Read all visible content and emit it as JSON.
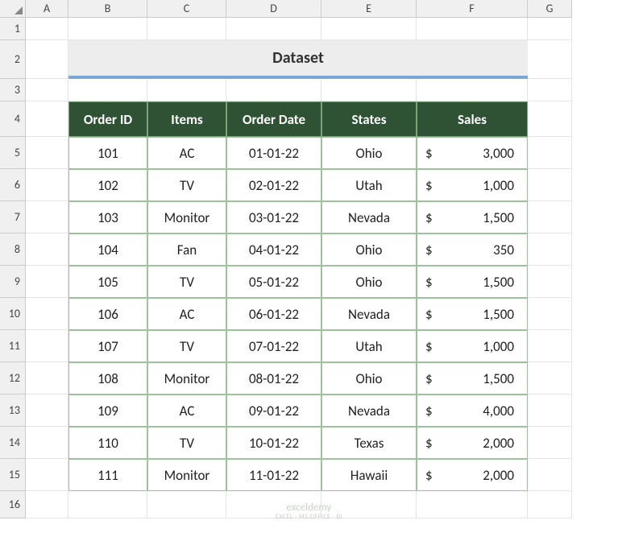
{
  "columns": [
    "",
    "A",
    "B",
    "C",
    "D",
    "E",
    "F",
    "G"
  ],
  "rows": [
    "1",
    "2",
    "3",
    "4",
    "5",
    "6",
    "7",
    "8",
    "9",
    "10",
    "11",
    "12",
    "13",
    "14",
    "15",
    "16"
  ],
  "title": "Dataset",
  "headers": [
    "Order ID",
    "Items",
    "Order Date",
    "States",
    "Sales"
  ],
  "data": [
    {
      "id": "101",
      "item": "AC",
      "date": "01-01-22",
      "state": "Ohio",
      "sales": "3,000"
    },
    {
      "id": "102",
      "item": "TV",
      "date": "02-01-22",
      "state": "Utah",
      "sales": "1,000"
    },
    {
      "id": "103",
      "item": "Monitor",
      "date": "03-01-22",
      "state": "Nevada",
      "sales": "1,500"
    },
    {
      "id": "104",
      "item": "Fan",
      "date": "04-01-22",
      "state": "Ohio",
      "sales": "350"
    },
    {
      "id": "105",
      "item": "TV",
      "date": "05-01-22",
      "state": "Ohio",
      "sales": "1,500"
    },
    {
      "id": "106",
      "item": "AC",
      "date": "06-01-22",
      "state": "Nevada",
      "sales": "1,500"
    },
    {
      "id": "107",
      "item": "TV",
      "date": "07-01-22",
      "state": "Utah",
      "sales": "1,000"
    },
    {
      "id": "108",
      "item": "Monitor",
      "date": "08-01-22",
      "state": "Ohio",
      "sales": "1,500"
    },
    {
      "id": "109",
      "item": "AC",
      "date": "09-01-22",
      "state": "Nevada",
      "sales": "4,000"
    },
    {
      "id": "110",
      "item": "TV",
      "date": "10-01-22",
      "state": "Texas",
      "sales": "2,000"
    },
    {
      "id": "111",
      "item": "Monitor",
      "date": "11-01-22",
      "state": "Hawaii",
      "sales": "2,000"
    }
  ],
  "currency": "$",
  "watermark": {
    "main": "exceldemy",
    "sub": "EXCEL · MS OFFICE · BI"
  }
}
